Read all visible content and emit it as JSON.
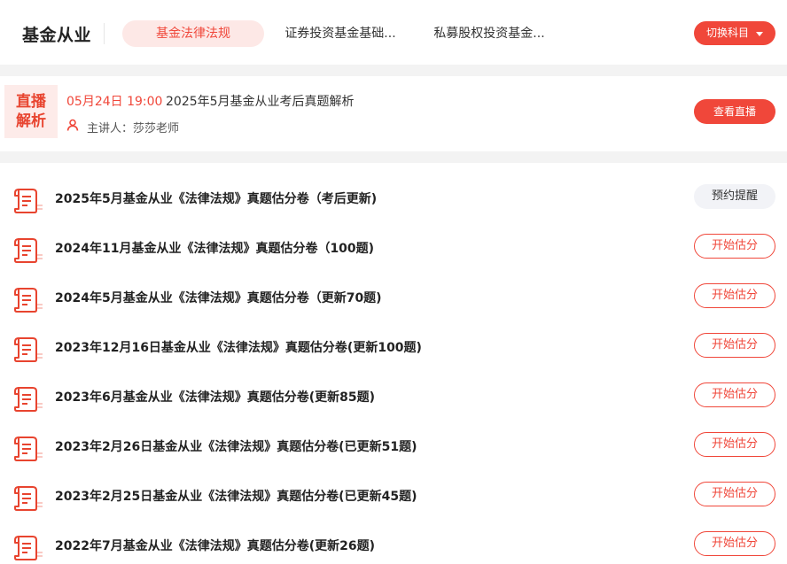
{
  "header": {
    "brand": "基金从业",
    "tabs": [
      {
        "label": "基金法律法规",
        "active": true
      },
      {
        "label": "证券投资基金基础...",
        "active": false
      },
      {
        "label": "私募股权投资基金...",
        "active": false
      }
    ],
    "switch_label": "切换科目"
  },
  "live": {
    "badge_line1": "直播",
    "badge_line2": "解析",
    "time": "05月24日 19:00",
    "title": "2025年5月基金从业考后真题解析",
    "host": "主讲人：莎莎老师",
    "watch_label": "查看直播"
  },
  "papers": [
    {
      "title": "2025年5月基金从业《法律法规》真题估分卷（考后更新)",
      "action": "预约提醒",
      "type": "remind"
    },
    {
      "title": "2024年11月基金从业《法律法规》真题估分卷（100题)",
      "action": "开始估分",
      "type": "start"
    },
    {
      "title": "2024年5月基金从业《法律法规》真题估分卷（更新70题)",
      "action": "开始估分",
      "type": "start"
    },
    {
      "title": "2023年12月16日基金从业《法律法规》真题估分卷(更新100题)",
      "action": "开始估分",
      "type": "start"
    },
    {
      "title": "2023年6月基金从业《法律法规》真题估分卷(更新85题)",
      "action": "开始估分",
      "type": "start"
    },
    {
      "title": "2023年2月26日基金从业《法律法规》真题估分卷(已更新51题)",
      "action": "开始估分",
      "type": "start"
    },
    {
      "title": "2023年2月25日基金从业《法律法规》真题估分卷(已更新45题)",
      "action": "开始估分",
      "type": "start"
    },
    {
      "title": "2022年7月基金从业《法律法规》真题估分卷(更新26题)",
      "action": "开始估分",
      "type": "start"
    }
  ],
  "colors": {
    "accent": "#f0473a",
    "accent_light": "#fde8e6",
    "neutral_btn": "#f2f3f7"
  },
  "icons": {
    "paper": "exam-paper-icon",
    "person": "person-icon",
    "caret": "caret-down-icon"
  }
}
